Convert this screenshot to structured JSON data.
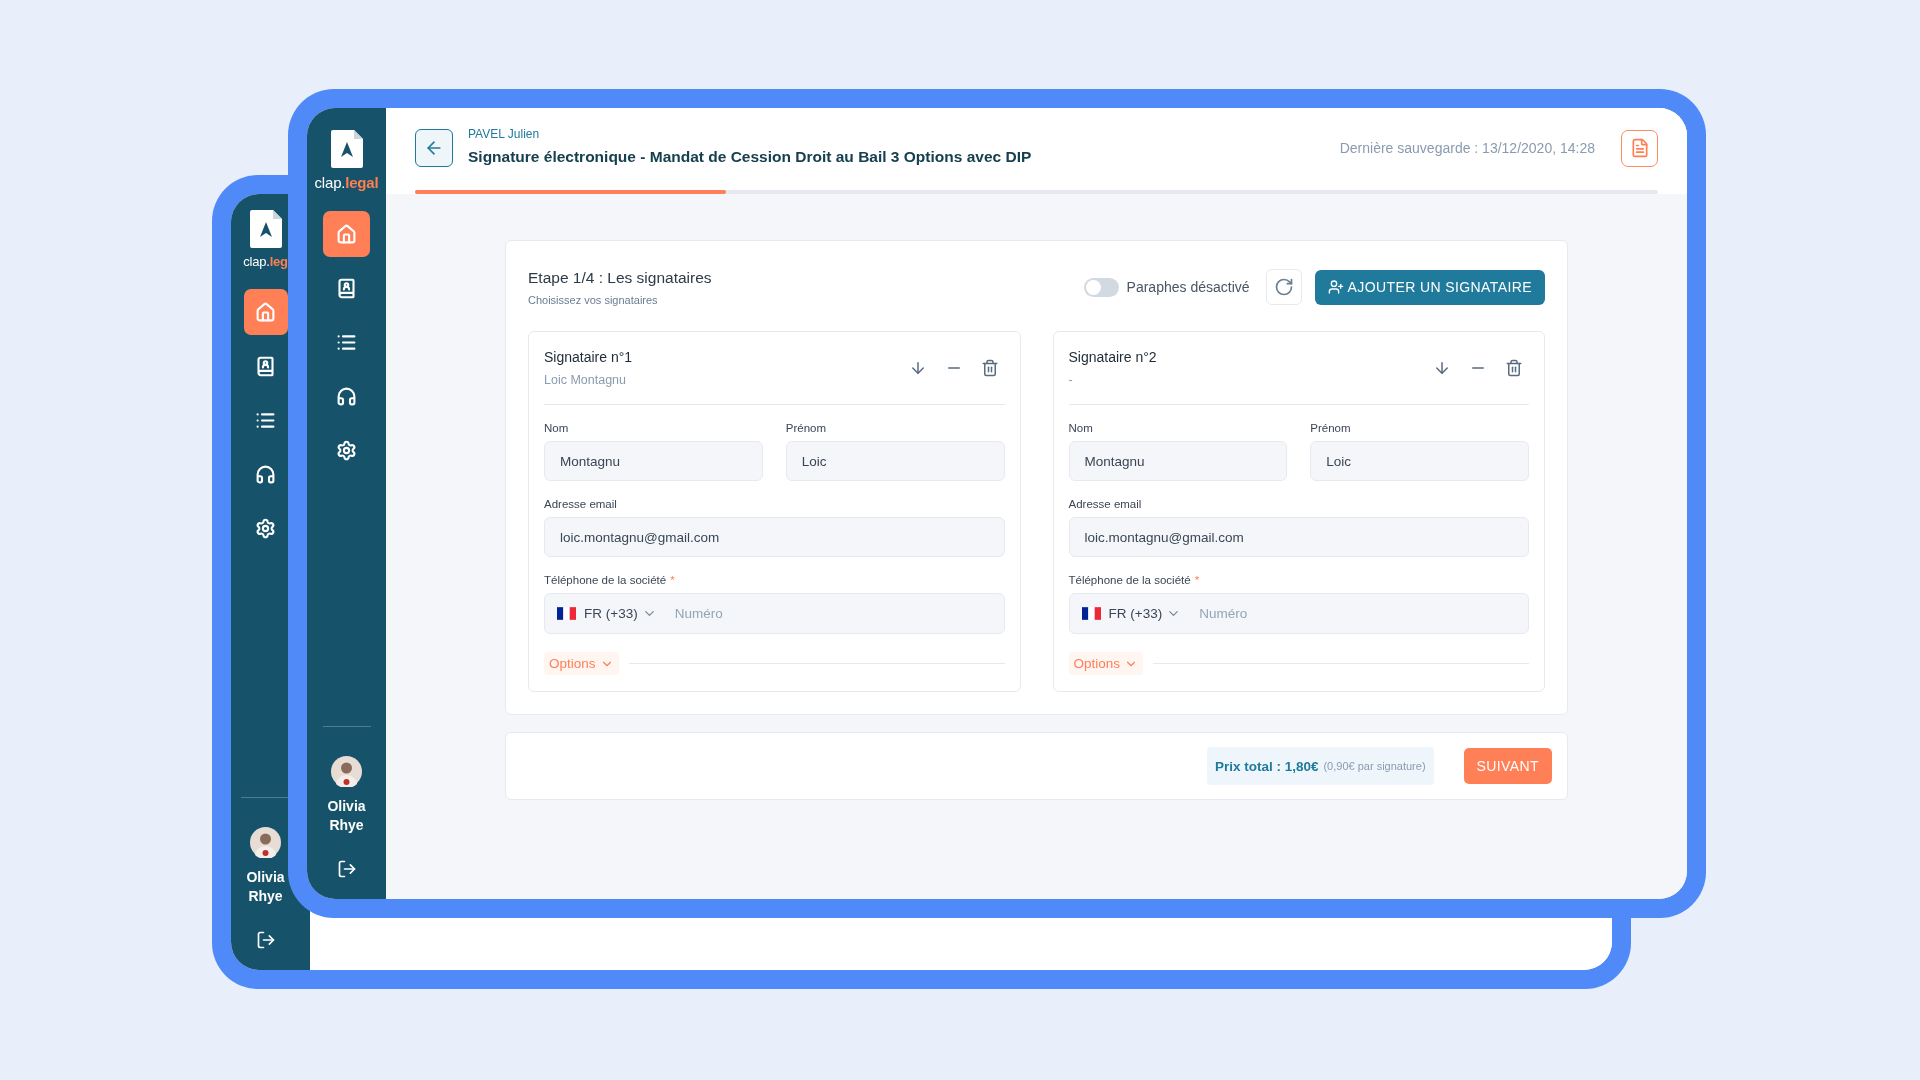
{
  "back_window": {
    "sidebar": {
      "logo": {
        "prefix": "clap.",
        "accent": "leg"
      },
      "nav": [
        {
          "selected": true
        },
        {
          "selected": false
        },
        {
          "selected": false
        },
        {
          "selected": false
        },
        {
          "selected": false
        }
      ],
      "user": "Olivia Rhye"
    }
  },
  "front_window": {
    "sidebar": {
      "logo": {
        "prefix": "clap.",
        "accent": "legal"
      },
      "nav": [
        {
          "selected": true
        },
        {
          "selected": false
        },
        {
          "selected": false
        },
        {
          "selected": false
        },
        {
          "selected": false
        }
      ],
      "user": "Olivia Rhye"
    },
    "header": {
      "client": "PAVEL Julien",
      "title": "Signature électronique - Mandat de Cession Droit au Bail 3 Options avec DIP",
      "last_saved": "Dernière sauvegarde : 13/12/2020, 14:28",
      "progress": {
        "level": 0.25
      }
    },
    "step": {
      "title": "Etape 1/4 : Les signataires",
      "subtitle": "Choisissez vos signataires",
      "toggle": {
        "label": "Paraphes désactivé",
        "on": false
      },
      "add_button": "AJOUTER UN SIGNATAIRE"
    },
    "signers": [
      {
        "title": "Signataire n°1",
        "subtitle": "Loic Montagnu",
        "rows": [
          [
            {
              "label": "Nom",
              "value": "Montagnu"
            },
            {
              "label": "Prénom",
              "value": "Loic"
            }
          ],
          [
            {
              "label": "Adresse email",
              "value": "loic.montagnu@gmail.com"
            }
          ]
        ],
        "phone": {
          "label": "Téléphone de la société",
          "required_mark": "*",
          "country": "FR (+33)",
          "placeholder": "Numéro"
        },
        "options": "Options"
      },
      {
        "title": "Signataire n°2",
        "subtitle": "-",
        "rows": [
          [
            {
              "label": "Nom",
              "value": "Montagnu"
            },
            {
              "label": "Prénom",
              "value": "Loic"
            }
          ],
          [
            {
              "label": "Adresse email",
              "value": "loic.montagnu@gmail.com"
            }
          ]
        ],
        "phone": {
          "label": "Téléphone de la société",
          "required_mark": "*",
          "country": "FR (+33)",
          "placeholder": "Numéro"
        },
        "options": "Options"
      }
    ],
    "footer": {
      "price": "Prix total : 1,80€",
      "note": "(0,90€ par signature)",
      "next_button": "SUIVANT"
    }
  }
}
